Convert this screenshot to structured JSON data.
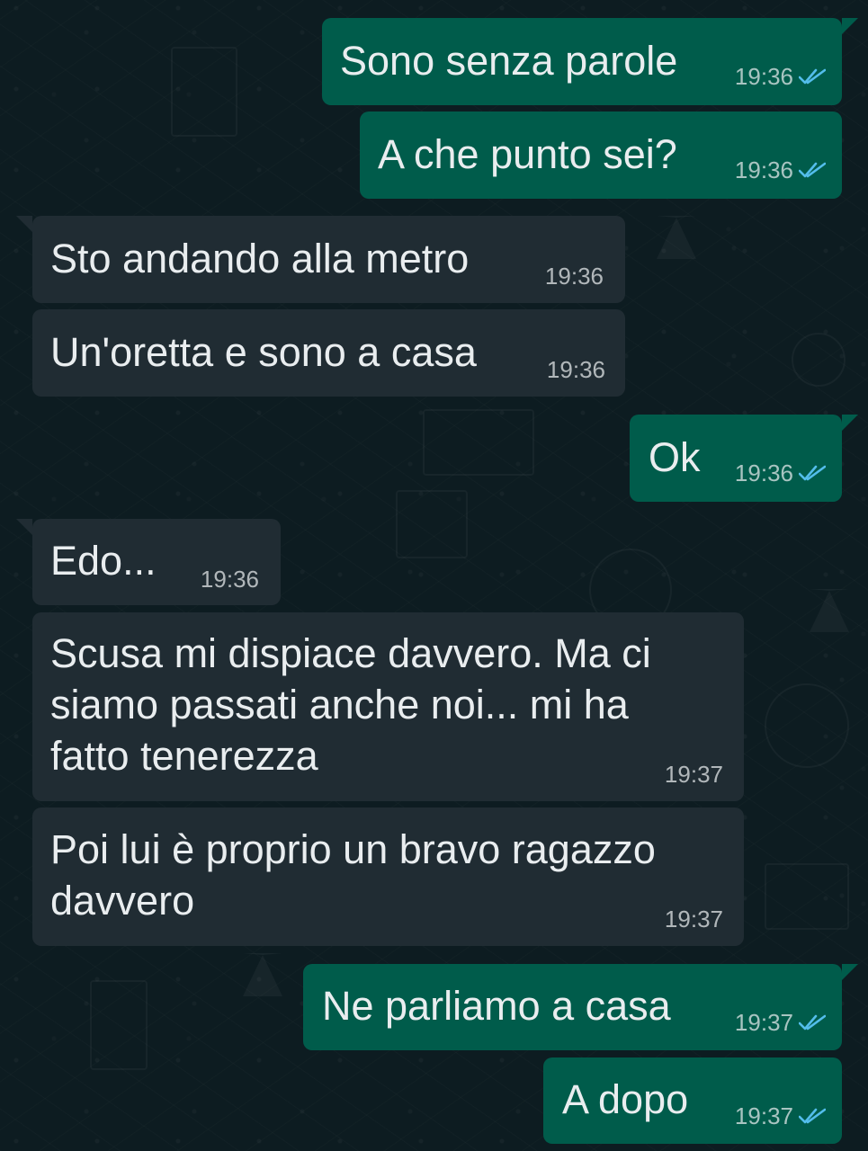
{
  "colors": {
    "background": "#0d1c21",
    "outgoing_bubble": "#005c4b",
    "incoming_bubble": "#202c33",
    "text": "#e9edef",
    "read_tick": "#53bdeb"
  },
  "messages": [
    {
      "direction": "out",
      "text": "Sono senza parole",
      "time": "19:36",
      "status_icon": "double-check-icon"
    },
    {
      "direction": "out",
      "text": "A che punto sei?",
      "time": "19:36",
      "status_icon": "double-check-icon"
    },
    {
      "direction": "in",
      "text": "Sto andando alla metro",
      "time": "19:36"
    },
    {
      "direction": "in",
      "text": "Un'oretta e sono a casa",
      "time": "19:36"
    },
    {
      "direction": "out",
      "text": "Ok",
      "time": "19:36",
      "status_icon": "double-check-icon"
    },
    {
      "direction": "in",
      "text": "Edo...",
      "time": "19:36"
    },
    {
      "direction": "in",
      "text": "Scusa mi dispiace davvero. Ma ci\nsiamo passati anche noi... mi ha\nfatto tenerezza",
      "time": "19:37"
    },
    {
      "direction": "in",
      "text": "Poi lui è proprio un bravo ragazzo\ndavvero",
      "time": "19:37"
    },
    {
      "direction": "out",
      "text": "Ne parliamo a casa",
      "time": "19:37",
      "status_icon": "double-check-icon"
    },
    {
      "direction": "out",
      "text": "A dopo",
      "time": "19:37",
      "status_icon": "double-check-icon"
    }
  ]
}
